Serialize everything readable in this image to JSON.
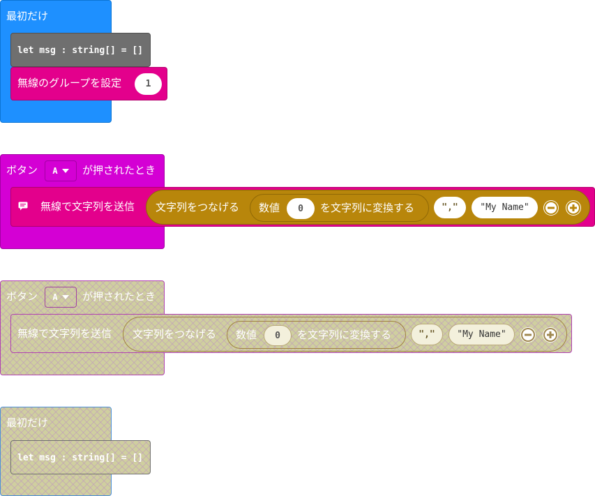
{
  "workspace": {
    "block1": {
      "hat_label": "最初だけ",
      "let_stmt": "let msg : string[] = []",
      "radio_group_label": "無線のグループを設定",
      "radio_group_value": "1"
    },
    "block2": {
      "hat_label_pre": "ボタン",
      "button_value": "A",
      "hat_label_post": "が押されたとき",
      "send_label": "無線で文字列を送信",
      "join_label": "文字列をつなげる",
      "number_label": "数値",
      "number_value": "0",
      "to_string_label": "を文字列に変換する",
      "str1": "\",\"",
      "str2": "\"My Name\""
    },
    "block3": {
      "hat_label_pre": "ボタン",
      "button_value": "A",
      "hat_label_post": "が押されたとき",
      "send_label": "無線で文字列を送信",
      "join_label": "文字列をつなげる",
      "number_label": "数値",
      "number_value": "0",
      "to_string_label": "を文字列に変換する",
      "str1": "\",\"",
      "str2": "\"My Name\""
    },
    "block4": {
      "hat_label": "最初だけ",
      "let_stmt": "let msg : string[] = []"
    }
  },
  "colors": {
    "basic_blue": "#1e90ff",
    "input_magenta": "#d400d4",
    "radio_pink": "#e3008c",
    "variables_gray": "#6f6f6f",
    "text_gold": "#b8860b",
    "disabled_fill": "#cfcf9f"
  },
  "icons": {
    "radio_send_icon": "chat-bubble-icon",
    "remove_icon": "minus-circle-icon",
    "add_icon": "plus-circle-icon"
  }
}
